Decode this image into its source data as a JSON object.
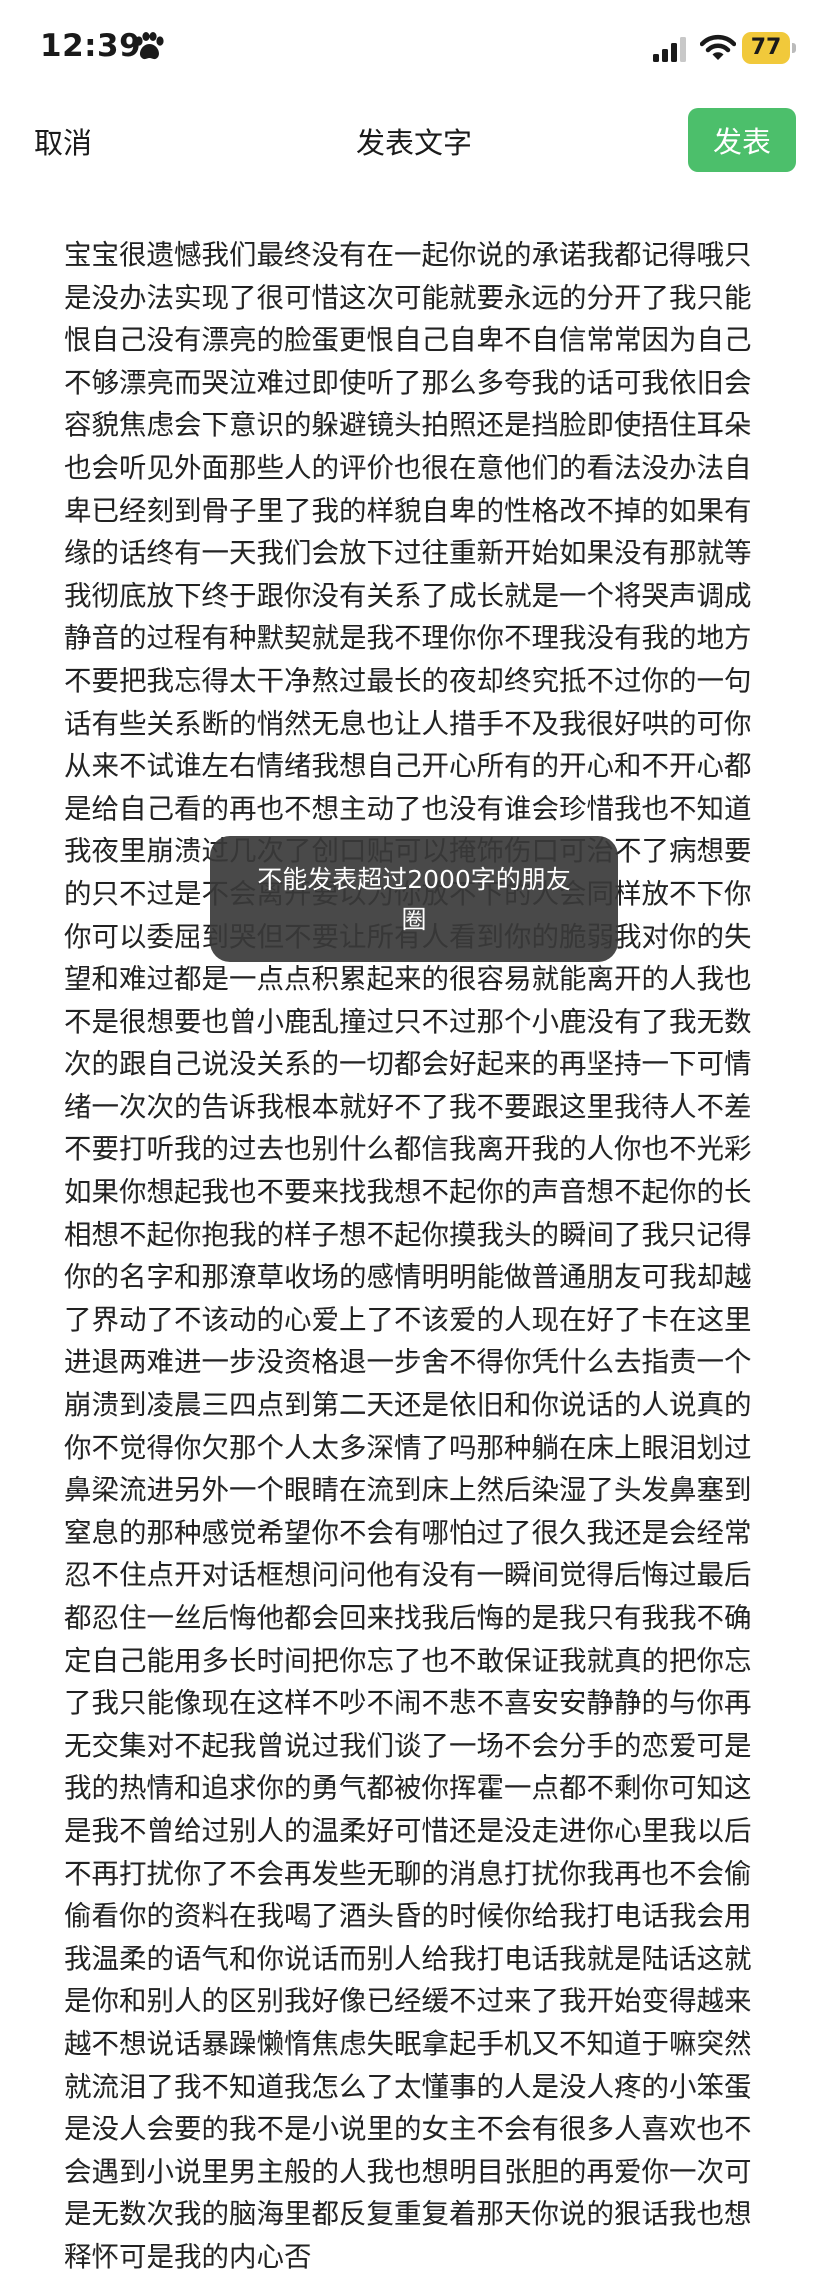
{
  "status_bar": {
    "time": "12:39",
    "battery": "77",
    "battery_color": "#f1c93b"
  },
  "nav": {
    "cancel_label": "取消",
    "title": "发表文字",
    "publish_label": "发表",
    "publish_color": "#4cbf6b"
  },
  "content": {
    "text": "宝宝很遗憾我们最终没有在一起你说的承诺我都记得哦只是没办法实现了很可惜这次可能就要永远的分开了我只能恨自己没有漂亮的脸蛋更恨自己自卑不自信常常因为自己不够漂亮而哭泣难过即使听了那么多夸我的话可我依旧会容貌焦虑会下意识的躲避镜头拍照还是挡脸即使捂住耳朵也会听见外面那些人的评价也很在意他们的看法没办法自卑已经刻到骨子里了我的样貌自卑的性格改不掉的如果有缘的话终有一天我们会放下过往重新开始如果没有那就等我彻底放下终于跟你没有关系了成长就是一个将哭声调成静音的过程有种默契就是我不理你你不理我没有我的地方不要把我忘得太干净熬过最长的夜却终究抵不过你的一句话有些关系断的悄然无息也让人措手不及我很好哄的可你从来不试谁左右情绪我想自己开心所有的开心和不开心都是给自己看的再也不想主动了也没有谁会珍惜我也不知道我夜里崩溃过几次了创口贴可以掩饰伤口可治不了病想要的只不过是不会离开要以为你放不下的人会同样放不下你你可以委屈到哭但不要让所有人看到你的脆弱我对你的失望和难过都是一点点积累起来的很容易就能离开的人我也不是很想要也曾小鹿乱撞过只不过那个小鹿没有了我无数次的跟自己说没关系的一切都会好起来的再坚持一下可情绪一次次的告诉我根本就好不了我不要跟这里我待人不差不要打听我的过去也别什么都信我离开我的人你也不光彩如果你想起我也不要来找我想不起你的声音想不起你的长相想不起你抱我的样子想不起你摸我头的瞬间了我只记得你的名字和那潦草收场的感情明明能做普通朋友可我却越了界动了不该动的心爱上了不该爱的人现在好了卡在这里进退两难进一步没资格退一步舍不得你凭什么去指责一个崩溃到凌晨三四点到第二天还是依旧和你说话的人说真的你不觉得你欠那个人太多深情了吗那种躺在床上眼泪划过鼻梁流进另外一个眼睛在流到床上然后染湿了头发鼻塞到窒息的那种感觉希望你不会有哪怕过了很久我还是会经常忍不住点开对话框想问问他有没有一瞬间觉得后悔过最后都忍住一丝后悔他都会回来找我后悔的是我只有我我不确定自己能用多长时间把你忘了也不敢保证我就真的把你忘了我只能像现在这样不吵不闹不悲不喜安安静静的与你再无交集对不起我曾说过我们谈了一场不会分手的恋爱可是我的热情和追求你的勇气都被你挥霍一点都不剩你可知这是我不曾给过别人的温柔好可惜还是没走进你心里我以后不再打扰你了不会再发些无聊的消息打扰你我再也不会偷偷看你的资料在我喝了酒头昏的时候你给我打电话我会用我温柔的语气和你说话而别人给我打电话我就是陆话这就是你和别人的区别我好像已经缓不过来了我开始变得越来越不想说话暴躁懒惰焦虑失眠拿起手机又不知道于嘛突然就流泪了我不知道我怎么了太懂事的人是没人疼的小笨蛋是没人会要的我不是小说里的女主不会有很多人喜欢也不会遇到小说里男主般的人我也想明目张胆的再爱你一次可是无数次我的脑海里都反复重复着那天你说的狠话我也想释怀可是我的内心否"
  },
  "toast": {
    "message": "不能发表超过2000字的朋友圈"
  }
}
